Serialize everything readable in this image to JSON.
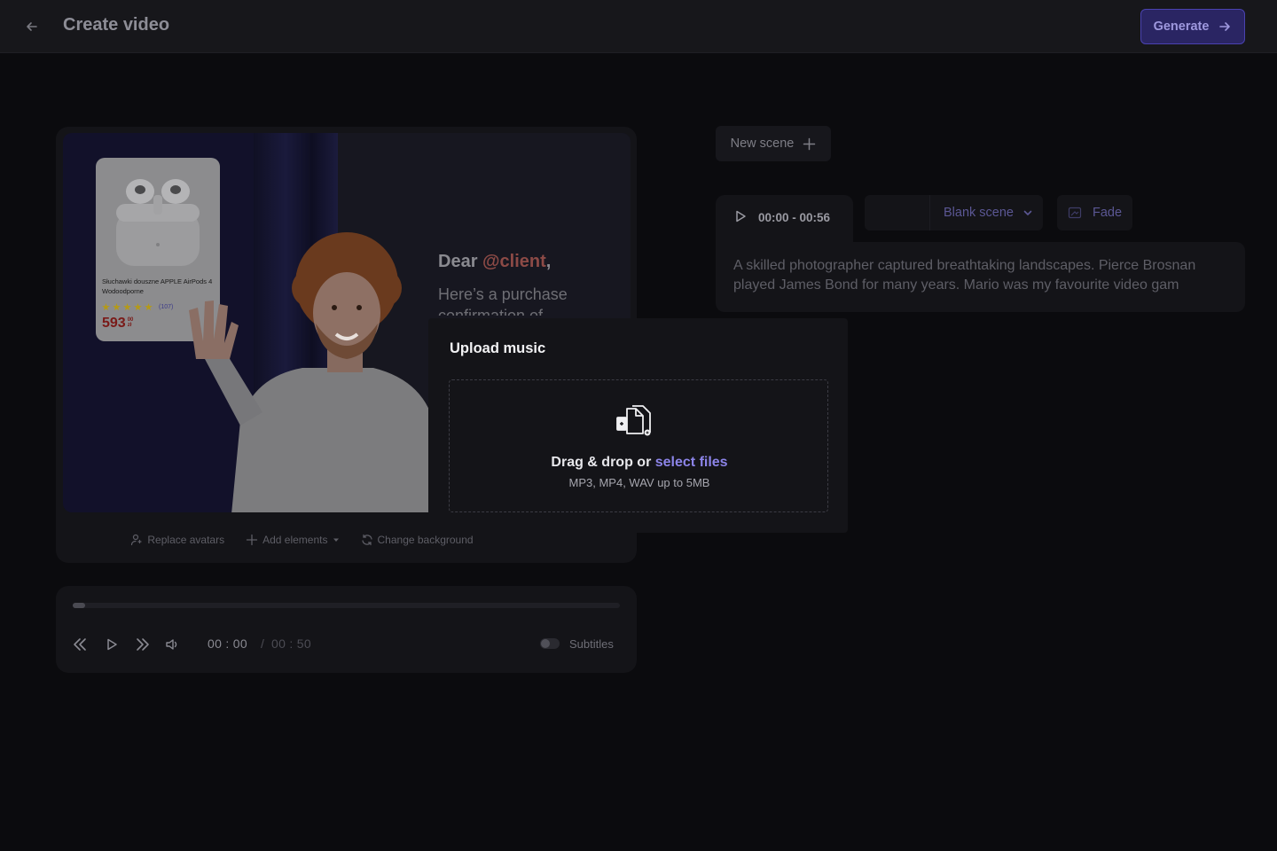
{
  "header": {
    "title": "Create video",
    "generate_label": "Generate"
  },
  "preview": {
    "product": {
      "name": "Słuchawki douszne APPLE AirPods 4 Wodoodporne",
      "rating_stars": 5,
      "reviews": "(107)",
      "price_main": "593",
      "price_cents": "00",
      "price_currency": "zł"
    },
    "greeting_prefix": "Dear ",
    "greeting_mention": "@client",
    "greeting_suffix": ",",
    "body_text": "Here’s a purchase confirmation of"
  },
  "preview_toolbar": {
    "replace_avatars": "Replace avatars",
    "add_elements": "Add elements",
    "change_background": "Change background"
  },
  "player": {
    "progress": 0.02,
    "current_time": "00 : 00",
    "separator": "/",
    "total_time": "00 : 50",
    "subtitles_label": "Subtitles",
    "subtitles_on": false
  },
  "scenes": {
    "new_scene_label": "New scene",
    "active": {
      "time_range": "00:00 - 00:56",
      "type_label": "Blank scene",
      "transition_label": "Fade",
      "script": "A skilled photographer captured breathtaking landscapes. Pierce Brosnan played James Bond for many years. Mario was my favourite video gam"
    }
  },
  "upload_modal": {
    "title": "Upload music",
    "drag_text": "Drag & drop or ",
    "select_link": "select files",
    "formats": "MP3, MP4, WAV up to 5MB"
  },
  "colors": {
    "background": "#0b0b0e",
    "accent": "#8c84e8",
    "generate_bg": "#2a2563",
    "mention": "#8c4a46"
  }
}
